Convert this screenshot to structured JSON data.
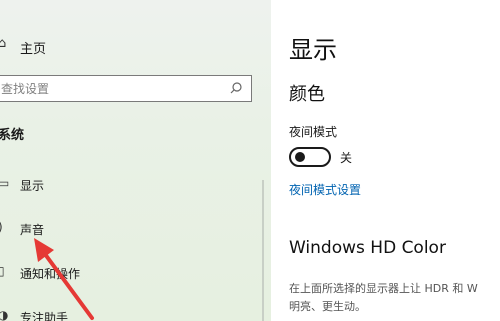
{
  "sidebar": {
    "home_label": "主页",
    "search_placeholder": "查找设置",
    "section_title": "系统",
    "items": [
      {
        "label": "显示",
        "icon": "monitor-icon"
      },
      {
        "label": "声音",
        "icon": "speaker-icon"
      },
      {
        "label": "通知和操作",
        "icon": "notification-icon"
      },
      {
        "label": "专注助手",
        "icon": "focus-assist-icon"
      }
    ]
  },
  "main": {
    "page_title": "显示",
    "color_section": "颜色",
    "night_mode_label": "夜间模式",
    "night_mode_state": "关",
    "night_mode_on": false,
    "night_mode_settings_link": "夜间模式设置",
    "hd_title": "Windows HD Color",
    "hd_desc_line1": "在上面所选择的显示器上让 HDR 和 W",
    "hd_desc_line2": "明亮、更生动。"
  },
  "colors": {
    "accent": "#0063b1",
    "annotation_arrow": "#e53935"
  }
}
